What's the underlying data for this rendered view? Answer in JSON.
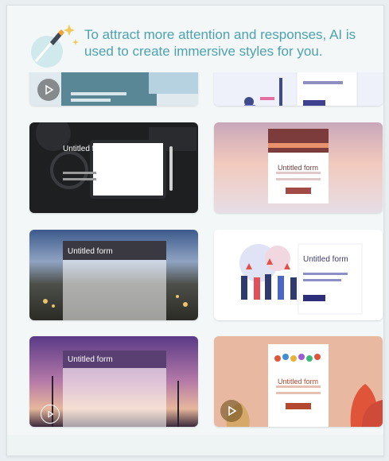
{
  "banner": {
    "message": "To attract more attention and responses, AI is used to create immersive styles for you."
  },
  "templates": [
    {
      "id": "t1",
      "title": ""
    },
    {
      "id": "t2",
      "title": ""
    },
    {
      "id": "t3",
      "title": "Untitled form"
    },
    {
      "id": "t4",
      "title": "Untitled form"
    },
    {
      "id": "t5",
      "title": "Untitled form"
    },
    {
      "id": "t6",
      "title": "Untitled form"
    },
    {
      "id": "t7",
      "title": "Untitled form"
    },
    {
      "id": "t8",
      "title": "Untitled form"
    }
  ],
  "colors": {
    "accent": "#4da2ad",
    "background": "#f3f7f8"
  },
  "icons": {
    "banner": "magic-brush-sparkle-icon",
    "play": "play-icon"
  }
}
